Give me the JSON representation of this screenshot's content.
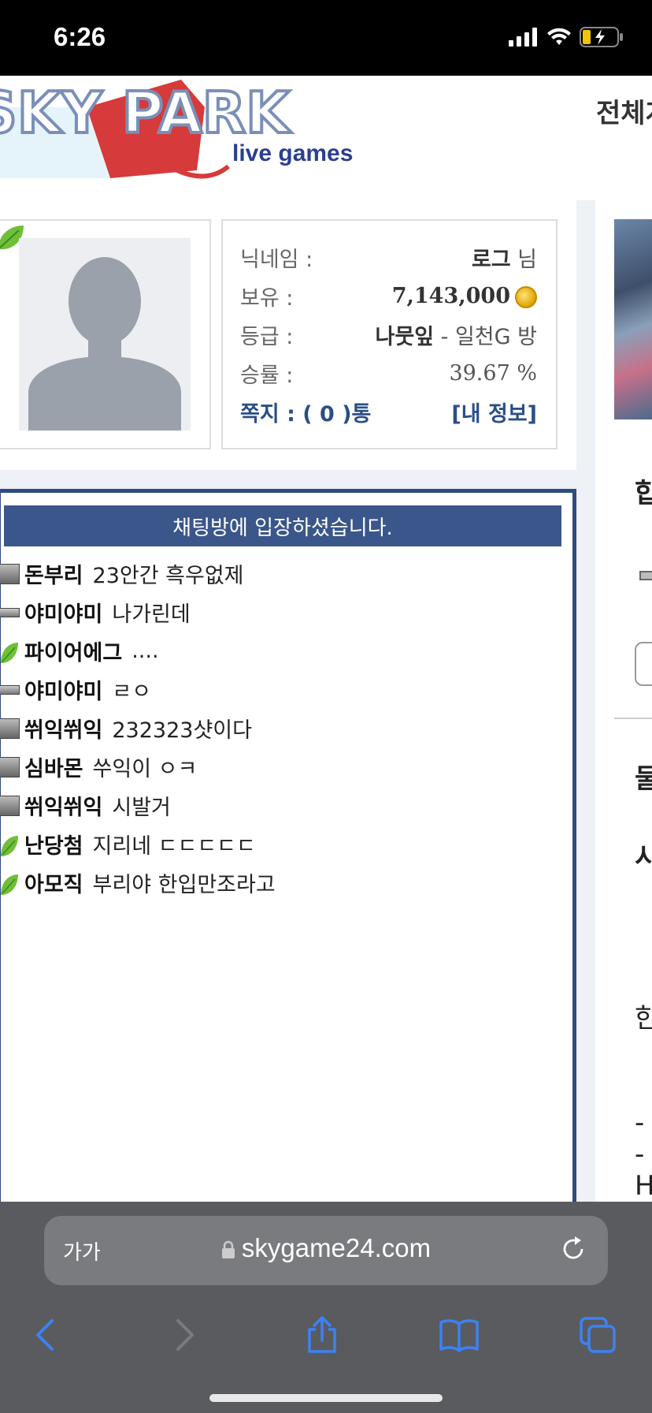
{
  "status_bar": {
    "time": "6:26"
  },
  "header": {
    "logo_main": "SKY PARK",
    "logo_sub": "live games",
    "menu_text": "전체게임"
  },
  "profile": {
    "nickname_label": "닉네임 :",
    "nickname": "로그",
    "nickname_suffix": "님",
    "balance_label": "보유 :",
    "balance": "7,143,000",
    "grade_label": "등급 :",
    "grade": "나뭇잎",
    "grade_room": "- 일천G 방",
    "winrate_label": "승률 :",
    "winrate": "39.67 %",
    "messages_label": "쪽지 : ( 0 )통",
    "my_info_link": "[내 정보]"
  },
  "chat": {
    "header": "채팅방에 입장하셨습니다.",
    "messages": [
      {
        "level": "grey",
        "nick": "돈부리",
        "text": "23안간 흑우없제"
      },
      {
        "level": "flat",
        "nick": "야미야미",
        "text": "나가린데"
      },
      {
        "level": "leaf",
        "nick": "파이어에그",
        "text": "...."
      },
      {
        "level": "flat",
        "nick": "야미야미",
        "text": "ㄹㅇ"
      },
      {
        "level": "grey",
        "nick": "쒸익쒸익",
        "text": "232323샷이다"
      },
      {
        "level": "grey",
        "nick": "심바몬",
        "text": "쑤익이 ㅇㅋ"
      },
      {
        "level": "grey",
        "nick": "쒸익쒸익",
        "text": "시발거"
      },
      {
        "level": "leaf",
        "nick": "난당첨",
        "text": "지리네 ㄷㄷㄷㄷㄷ"
      },
      {
        "level": "leaf",
        "nick": "아모직",
        "text": "부리야 한입만조라고"
      }
    ]
  },
  "right_column": {
    "char1": "합",
    "char2": "물",
    "char3": "시",
    "char4": "한",
    "char5": "--",
    "char6": "H"
  },
  "safari": {
    "text_size": "가가",
    "url": "skygame24.com"
  }
}
